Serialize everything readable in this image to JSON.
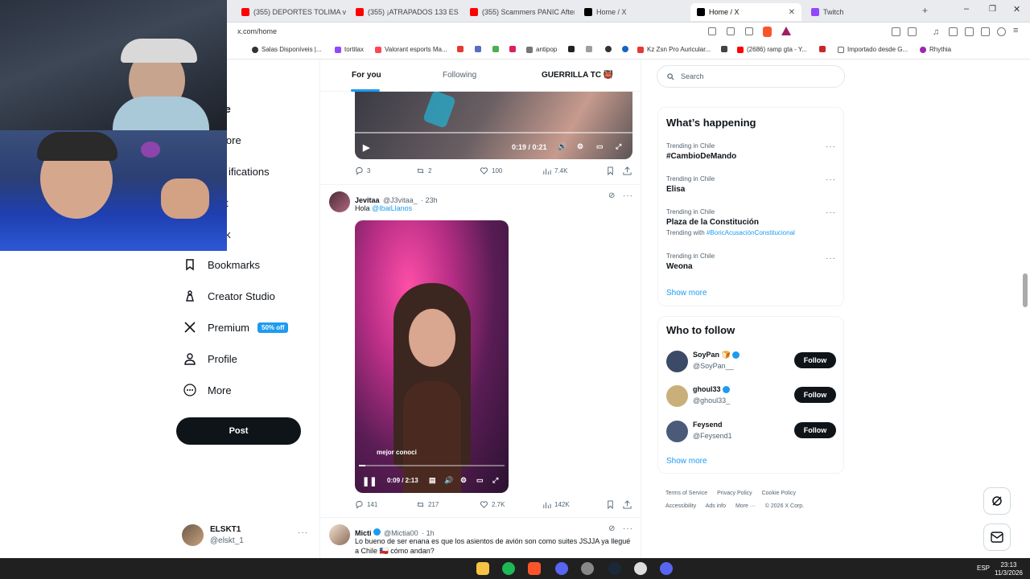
{
  "browser": {
    "tabs": [
      {
        "title": "(355) DEPORTES TOLIMA vs C",
        "favicon_color": "#ff0000"
      },
      {
        "title": "(355) ¡ATRAPADOS 133 ES ÉPIC",
        "favicon_color": "#ff0000"
      },
      {
        "title": "(355) Scammers PANIC After",
        "favicon_color": "#ff0000"
      },
      {
        "title": "Home / X",
        "favicon_color": "#000000"
      },
      {
        "title": "Home / X",
        "favicon_color": "#000000",
        "active": true
      },
      {
        "title": "Twitch",
        "favicon_color": "#9146ff"
      }
    ],
    "url": "x.com/home",
    "bookmarks": [
      {
        "label": "Salas Disponíveis |...",
        "color": "#333333"
      },
      {
        "label": "tortitax",
        "color": "#9146ff"
      },
      {
        "label": "Valorant esports Ma...",
        "color": "#ff4655"
      },
      {
        "label": "antipop",
        "color": "#777777"
      },
      {
        "label": "Kz Zsn Pro Auricular...",
        "color": "#e53935"
      },
      {
        "label": "(2686) ramp gta - Y...",
        "color": "#ff0000"
      },
      {
        "label": "Importado desde G...",
        "color": "#666666"
      },
      {
        "label": "Rhythia",
        "color": "#9c27b0"
      }
    ]
  },
  "nav": {
    "items": [
      {
        "label": "Bookmarks",
        "icon": "bookmark-icon"
      },
      {
        "label": "Creator Studio",
        "icon": "creator-icon"
      },
      {
        "label": "Premium",
        "icon": "x-logo-icon",
        "badge": "50% off"
      },
      {
        "label": "Profile",
        "icon": "person-icon"
      },
      {
        "label": "More",
        "icon": "more-circle-icon"
      }
    ],
    "partial_labels": [
      "me",
      "lore",
      "ifications",
      "t",
      "k"
    ],
    "post_label": "Post",
    "account": {
      "name": "ELSKT1",
      "handle": "@elskt_1"
    }
  },
  "feed": {
    "tabs": [
      "For you",
      "Following",
      "GUERRILLA TC 👹"
    ],
    "tweet1": {
      "video_time": "0:19 / 0:21",
      "replies": "3",
      "retweets": "2",
      "likes": "100",
      "views": "7.4K"
    },
    "tweet2": {
      "name": "Jevitaa",
      "handle": "@J3vitaa_",
      "time": "· 23h",
      "text_prefix": "Hola ",
      "mention": "@IbaiLlanos",
      "video_time": "0:09 / 2:13",
      "caption": "mejor conoci",
      "replies": "141",
      "retweets": "217",
      "likes": "2.7K",
      "views": "142K"
    },
    "tweet3": {
      "name": "Micti",
      "handle": "@Mictia00",
      "time": "· 1h",
      "text": "Lo bueno de ser enana es que los asientos de avión son como suites JSJJA ya llegué a Chile 🇨🇱 cómo andan?"
    }
  },
  "sidebar": {
    "search_placeholder": "Search",
    "happening_title": "What’s happening",
    "trends": [
      {
        "category": "Trending in Chile",
        "name": "#CambioDeMando"
      },
      {
        "category": "Trending in Chile",
        "name": "Elisa"
      },
      {
        "category": "Trending in Chile",
        "name": "Plaza de la Constitución",
        "with_prefix": "Trending with ",
        "with_tag": "#BoricAcusaciónConstitucional"
      },
      {
        "category": "Trending in Chile",
        "name": "Weona"
      }
    ],
    "show_more": "Show more",
    "who_title": "Who to follow",
    "follow": [
      {
        "name": "SoyPan 🍞",
        "handle": "@SoyPan__",
        "avatar_color": "#3b4a66"
      },
      {
        "name": "ghoul33",
        "handle": "@ghoul33_",
        "avatar_color": "#c9b07a"
      },
      {
        "name": "Feysend",
        "handle": "@Feysend1",
        "avatar_color": "#4c5a7a"
      }
    ],
    "follow_label": "Follow",
    "footer": [
      "Terms of Service",
      "Privacy Policy",
      "Cookie Policy",
      "Accessibility",
      "Ads info",
      "More ···",
      "© 2026 X Corp."
    ]
  },
  "taskbar": {
    "time": "23:13",
    "date": "11/3/2026",
    "lang": "ESP"
  }
}
